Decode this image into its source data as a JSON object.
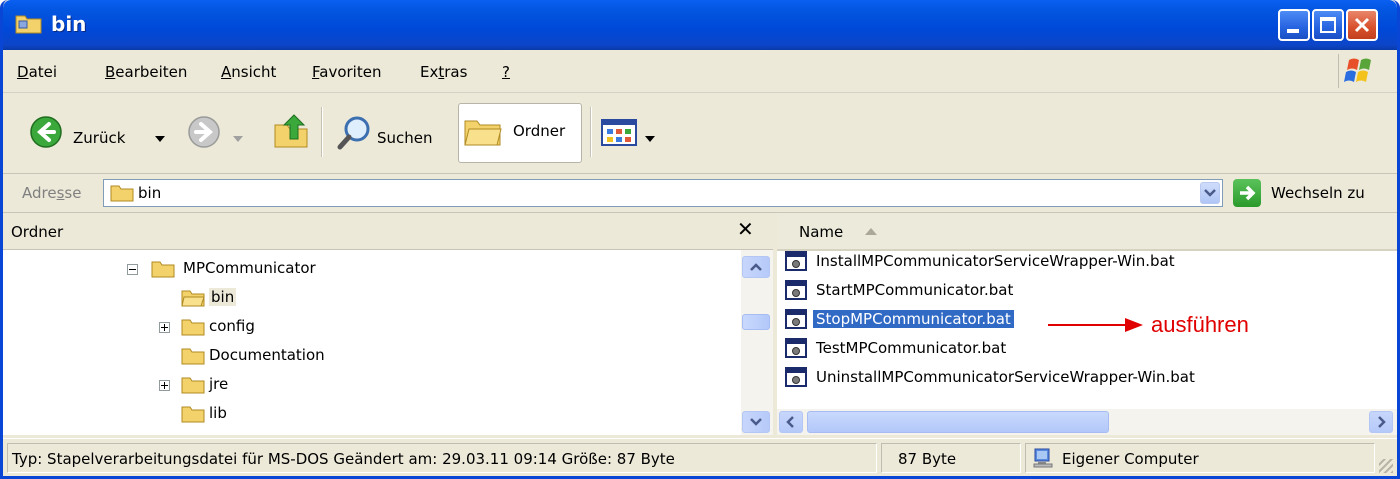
{
  "window": {
    "title": "bin"
  },
  "menu": [
    {
      "pre": "",
      "acc": "D",
      "post": "atei"
    },
    {
      "pre": "",
      "acc": "B",
      "post": "earbeiten"
    },
    {
      "pre": "",
      "acc": "A",
      "post": "nsicht"
    },
    {
      "pre": "",
      "acc": "F",
      "post": "avoriten"
    },
    {
      "pre": "Ex",
      "acc": "t",
      "post": "ras"
    },
    {
      "pre": "",
      "acc": "?",
      "post": ""
    }
  ],
  "toolbar": {
    "back_label": "Zurück",
    "search_label": "Suchen",
    "folders_label": "Ordner"
  },
  "address": {
    "label_pre": "Adre",
    "label_acc": "s",
    "label_post": "se",
    "value": "bin",
    "go_label": "Wechseln zu"
  },
  "folder_pane": {
    "title": "Ordner",
    "close_glyph": "✕",
    "tree": [
      {
        "label": "MPCommunicator",
        "expander": "minus",
        "level": 0,
        "selected": false
      },
      {
        "label": "bin",
        "expander": "none",
        "level": 1,
        "selected": true
      },
      {
        "label": "config",
        "expander": "plus",
        "level": 1,
        "selected": false
      },
      {
        "label": "Documentation",
        "expander": "none",
        "level": 1,
        "selected": false
      },
      {
        "label": "jre",
        "expander": "plus",
        "level": 1,
        "selected": false
      },
      {
        "label": "lib",
        "expander": "none",
        "level": 1,
        "selected": false
      }
    ]
  },
  "file_pane": {
    "column_name": "Name",
    "files": [
      {
        "name": "InstallMPCommunicatorServiceWrapper-Win.bat",
        "selected": false
      },
      {
        "name": "StartMPCommunicator.bat",
        "selected": false
      },
      {
        "name": "StopMPCommunicator.bat",
        "selected": true
      },
      {
        "name": "TestMPCommunicator.bat",
        "selected": false
      },
      {
        "name": "UninstallMPCommunicatorServiceWrapper-Win.bat",
        "selected": false
      }
    ]
  },
  "annotation": {
    "text": "ausführen",
    "color": "#e00000"
  },
  "status": {
    "info": "Typ: Stapelverarbeitungsdatei für MS-DOS Geändert am: 29.03.11 09:14 Größe: 87 Byte",
    "size": "87 Byte",
    "zone": "Eigener Computer"
  },
  "colors": {
    "title_blue": "#0048d8",
    "selection": "#316ac5",
    "chrome": "#ece9d8"
  }
}
